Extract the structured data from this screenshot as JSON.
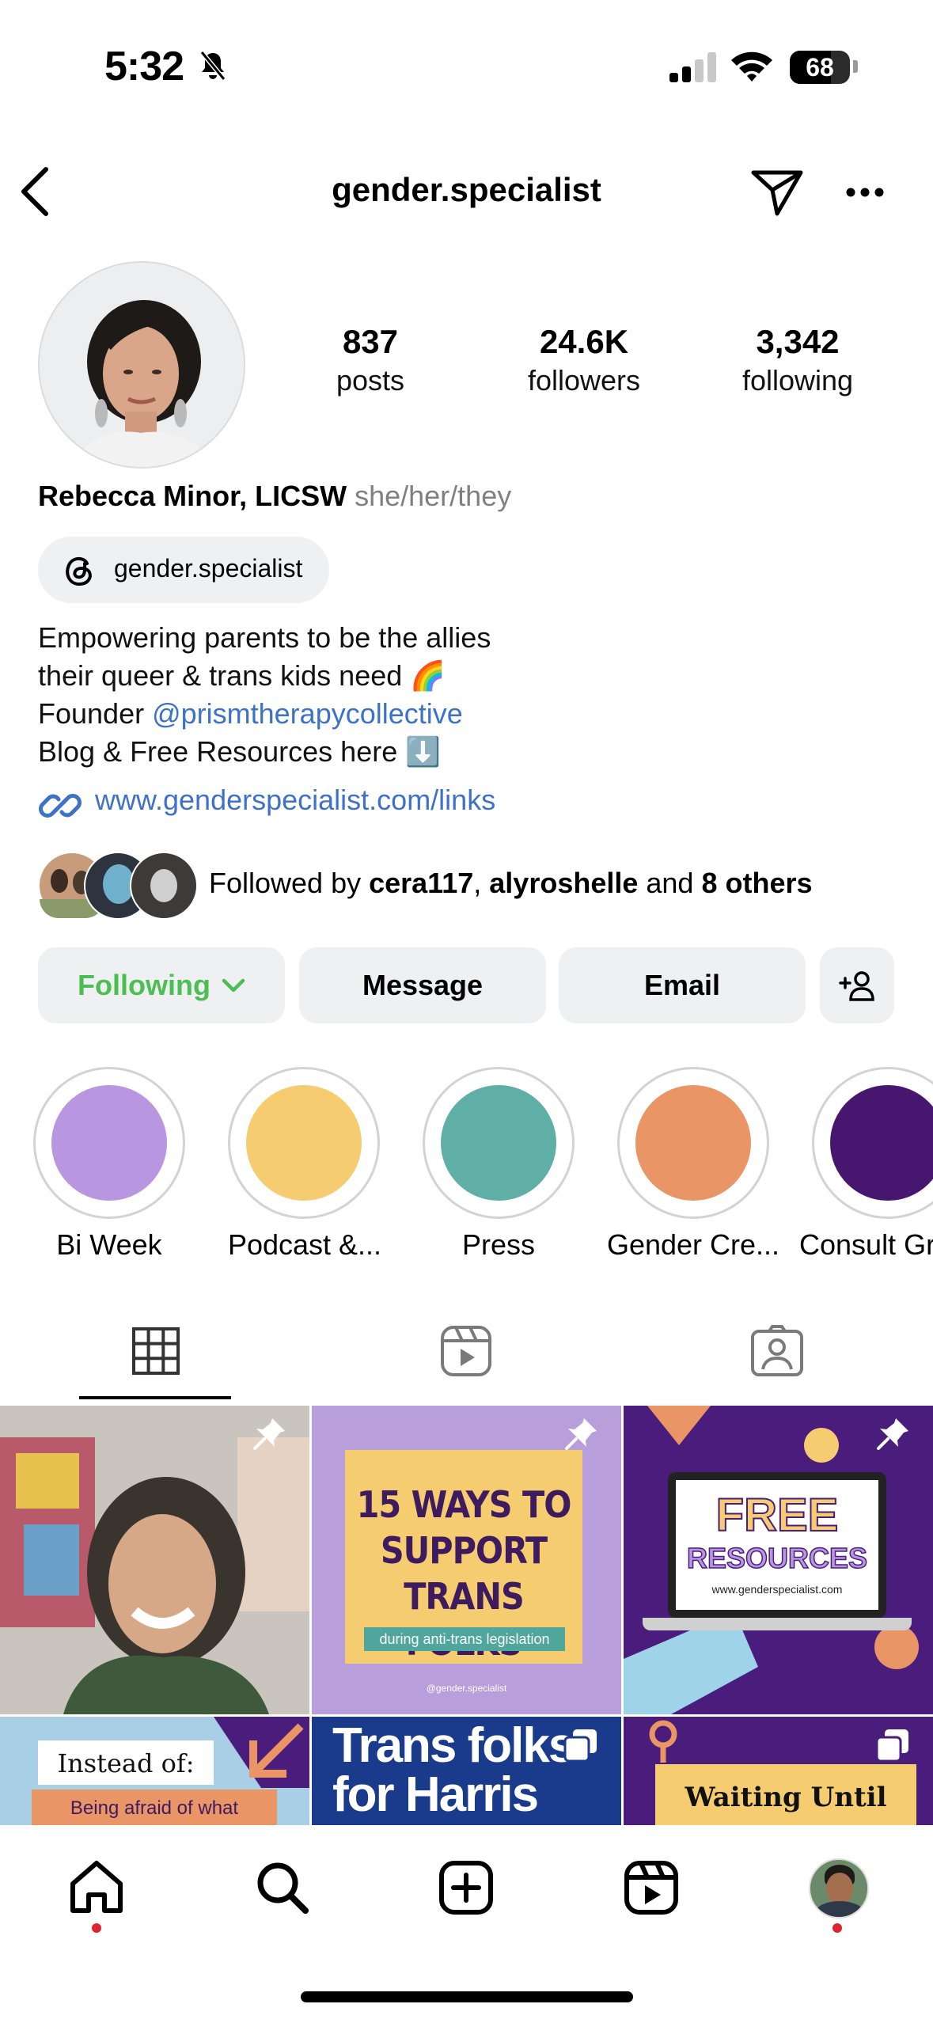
{
  "status_bar": {
    "time": "5:32",
    "battery": "68"
  },
  "header": {
    "username": "gender.specialist"
  },
  "profile": {
    "stats": [
      {
        "value": "837",
        "label": "posts"
      },
      {
        "value": "24.6K",
        "label": "followers"
      },
      {
        "value": "3,342",
        "label": "following"
      }
    ],
    "name": "Rebecca Minor, LICSW",
    "pronouns": "she/her/they",
    "threads_handle": "gender.specialist",
    "bio": {
      "line1": "Empowering parents to be the allies",
      "line2": "their queer & trans kids need 🌈",
      "line3_prefix": "Founder ",
      "line3_mention": "@prismtherapycollective",
      "line4": "Blog & Free Resources here ⬇️"
    },
    "link": "www.genderspecialist.com/links",
    "followed_by": {
      "prefix": "Followed by ",
      "user1": "cera117",
      "sep": ", ",
      "user2": "alyroshelle",
      "and": " and ",
      "others": "8 others"
    }
  },
  "actions": {
    "following": "Following",
    "message": "Message",
    "email": "Email"
  },
  "highlights": [
    {
      "label": "Bi Week",
      "color": "#b896e0"
    },
    {
      "label": "Podcast &...",
      "color": "#f5cd70"
    },
    {
      "label": "Press",
      "color": "#5fafa6"
    },
    {
      "label": "Gender Cre...",
      "color": "#ea9566"
    },
    {
      "label": "Consult Gr",
      "color": "#47166f"
    }
  ],
  "posts": {
    "p2": {
      "line1": "15 WAYS TO",
      "line2": "SUPPORT",
      "line3": "TRANS FOLKS",
      "sub": "during anti-trans legislation",
      "handle": "@gender.specialist"
    },
    "p3": {
      "line1": "FREE",
      "line2": "RESOURCES",
      "url": "www.genderspecialist.com"
    },
    "p4": {
      "line1": "Instead of:",
      "line2": "Being afraid of what"
    },
    "p5": {
      "line1": "Trans folks",
      "line2": "for Harris"
    },
    "p6": {
      "line1": "Waiting Until"
    }
  },
  "colors": {
    "link_blue": "#3d72c7",
    "following_green": "#4cbe53",
    "notif_red": "#e0242e"
  }
}
